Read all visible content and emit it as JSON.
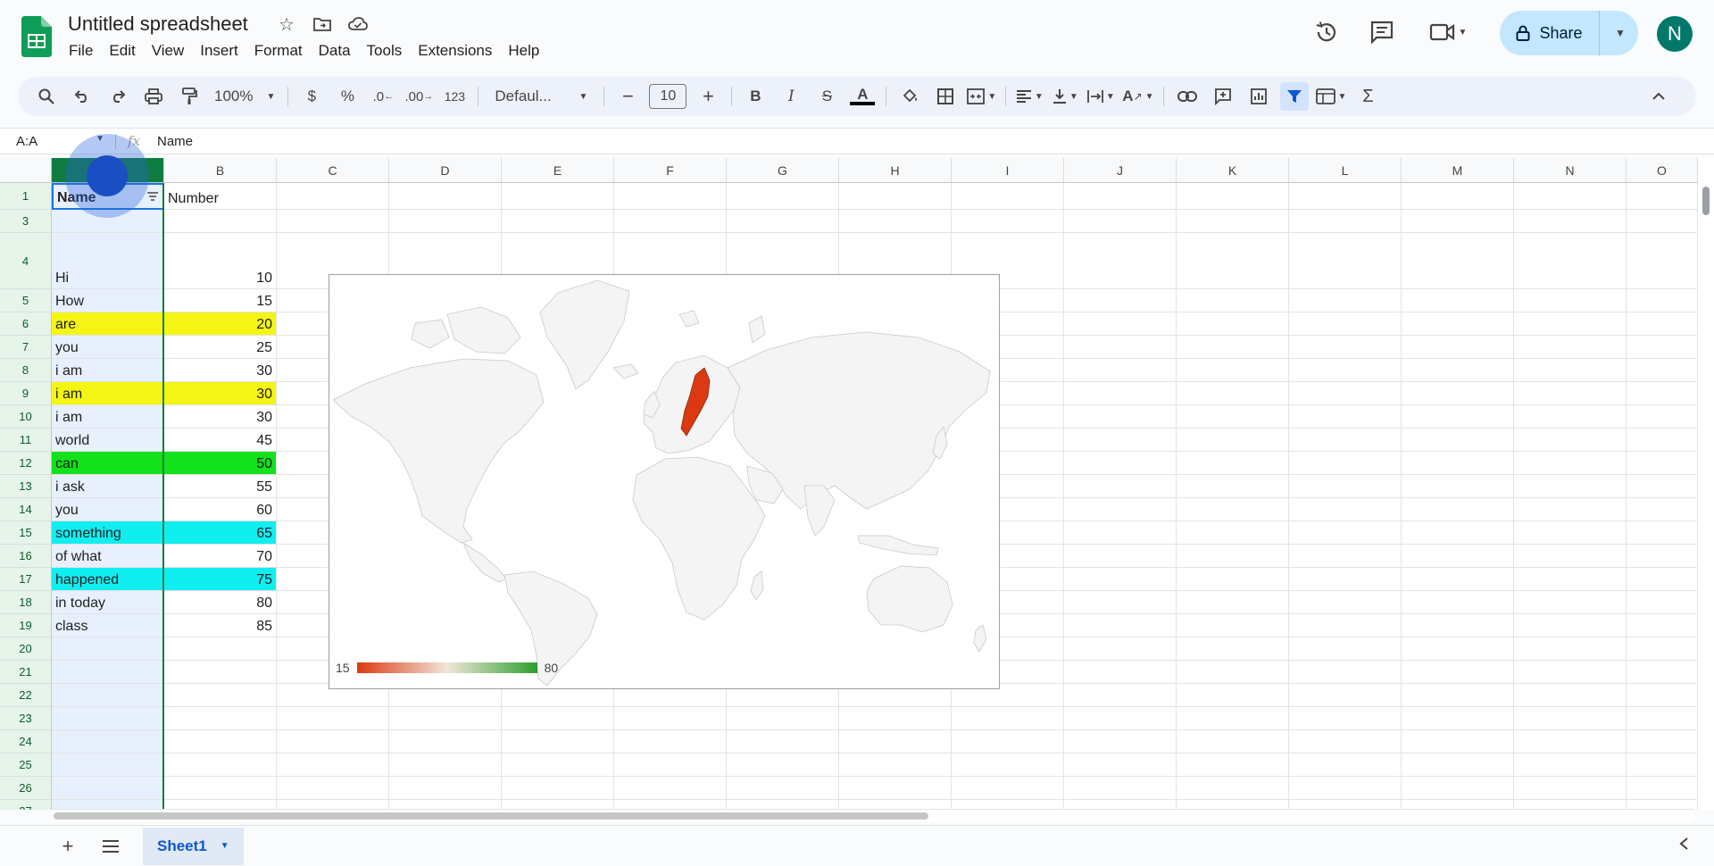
{
  "app": {
    "doc_title": "Untitled spreadsheet",
    "menu": [
      "File",
      "Edit",
      "View",
      "Insert",
      "Format",
      "Data",
      "Tools",
      "Extensions",
      "Help"
    ],
    "share_label": "Share",
    "avatar_initial": "N"
  },
  "toolbar": {
    "zoom": "100%",
    "currency": "$",
    "percent": "%",
    "dec_decrease": ".0",
    "dec_increase": ".00",
    "number_format": "123",
    "font": "Defaul...",
    "font_size": "10"
  },
  "formula_bar": {
    "name_box": "A:A",
    "fx": "fx",
    "value": "Name"
  },
  "sheet": {
    "columns": [
      "A",
      "B",
      "C",
      "D",
      "E",
      "F",
      "G",
      "H",
      "I",
      "J",
      "K",
      "L",
      "M",
      "N",
      "O"
    ],
    "rows": [
      {
        "n": "1",
        "a": "Name",
        "b": "Number"
      },
      {
        "n": "3",
        "a": "",
        "b": ""
      },
      {
        "n": "4",
        "a": "Hi",
        "b": "10"
      },
      {
        "n": "5",
        "a": "How",
        "b": "15"
      },
      {
        "n": "6",
        "a": "are",
        "b": "20",
        "fill": "#f5f515"
      },
      {
        "n": "7",
        "a": "you",
        "b": "25"
      },
      {
        "n": "8",
        "a": "i am",
        "b": "30"
      },
      {
        "n": "9",
        "a": "i am",
        "b": "30",
        "fill": "#f5f515"
      },
      {
        "n": "10",
        "a": "i am",
        "b": "30"
      },
      {
        "n": "11",
        "a": "world",
        "b": "45"
      },
      {
        "n": "12",
        "a": "can",
        "b": "50",
        "fill": "#12e11c"
      },
      {
        "n": "13",
        "a": "i ask",
        "b": "55"
      },
      {
        "n": "14",
        "a": "you",
        "b": "60"
      },
      {
        "n": "15",
        "a": "something",
        "b": "65",
        "fill": "#11eef0"
      },
      {
        "n": "16",
        "a": "of what",
        "b": "70"
      },
      {
        "n": "17",
        "a": "happened",
        "b": "75",
        "fill": "#11eef0"
      },
      {
        "n": "18",
        "a": "in today",
        "b": "80"
      },
      {
        "n": "19",
        "a": "class",
        "b": "85"
      },
      {
        "n": "20",
        "a": "",
        "b": ""
      },
      {
        "n": "21",
        "a": "",
        "b": ""
      },
      {
        "n": "22",
        "a": "",
        "b": ""
      },
      {
        "n": "23",
        "a": "",
        "b": ""
      },
      {
        "n": "24",
        "a": "",
        "b": ""
      },
      {
        "n": "25",
        "a": "",
        "b": ""
      },
      {
        "n": "26",
        "a": "",
        "b": ""
      },
      {
        "n": "27",
        "a": "",
        "b": ""
      }
    ],
    "selected_column": "A"
  },
  "chart": {
    "type": "geo",
    "legend_min": "15",
    "legend_max": "80",
    "highlighted_region": "Sweden",
    "colors": {
      "min": "#dc3912",
      "max": "#2ba02d",
      "highlight": "#dc3912",
      "land": "#f5f5f5"
    }
  },
  "bottom": {
    "sheet_tab": "Sheet1"
  }
}
